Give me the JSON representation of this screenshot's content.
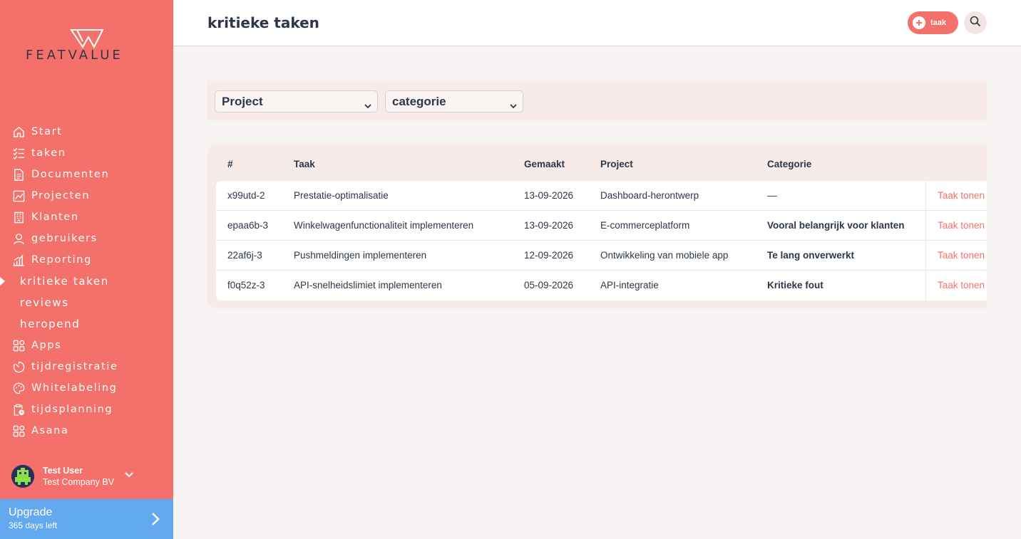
{
  "brand": {
    "name": "FEATVALUE"
  },
  "colors": {
    "accent": "#f4716b",
    "upgrade": "#63a9ef",
    "text": "#2d3748"
  },
  "sidebar": {
    "items": [
      {
        "label": "Start",
        "icon": "home-icon"
      },
      {
        "label": "taken",
        "icon": "tasklist-icon"
      },
      {
        "label": "Documenten",
        "icon": "document-icon"
      },
      {
        "label": "Projecten",
        "icon": "chart-board-icon"
      },
      {
        "label": "Klanten",
        "icon": "building-icon"
      },
      {
        "label": "gebruikers",
        "icon": "user-icon"
      },
      {
        "label": "Reporting",
        "icon": "bar-chart-icon"
      },
      {
        "label": "kritieke taken",
        "active": true
      },
      {
        "label": "reviews"
      },
      {
        "label": "heropend"
      },
      {
        "label": "Apps",
        "icon": "apps-icon"
      },
      {
        "label": "tijdregistratie",
        "icon": "timer-icon"
      },
      {
        "label": "Whitelabeling",
        "icon": "palette-icon"
      },
      {
        "label": "tijdsplanning",
        "icon": "clipboard-clock-icon"
      },
      {
        "label": "Asana",
        "icon": "apps-icon"
      }
    ],
    "user": {
      "name": "Test User",
      "company": "Test Company BV"
    },
    "upgrade": {
      "title": "Upgrade",
      "subtitle": "365 days left"
    }
  },
  "header": {
    "title": "kritieke taken",
    "add_label": "taak"
  },
  "filters": {
    "project": "Project",
    "category": "categorie"
  },
  "table": {
    "columns": [
      "#",
      "Taak",
      "Gemaakt",
      "Project",
      "Categorie"
    ],
    "rows": [
      {
        "id": "x99utd-2",
        "task": "Prestatie-optimalisatie",
        "created": "13-09-2026",
        "project": "Dashboard-herontwerp",
        "category": "—",
        "action": "Taak tonen"
      },
      {
        "id": "epaa6b-3",
        "task": "Winkelwagenfunctionaliteit implementeren",
        "created": "13-09-2026",
        "project": "E-commerceplatform",
        "category": "Vooral belangrijk voor klanten",
        "action": "Taak tonen"
      },
      {
        "id": "22af6j-3",
        "task": "Pushmeldingen implementeren",
        "created": "12-09-2026",
        "project": "Ontwikkeling van mobiele app",
        "category": "Te lang onverwerkt",
        "action": "Taak tonen"
      },
      {
        "id": "f0q52z-3",
        "task": "API-snelheidslimiet implementeren",
        "created": "05-09-2026",
        "project": "API-integratie",
        "category": "Kritieke fout",
        "action": "Taak tonen"
      }
    ]
  }
}
